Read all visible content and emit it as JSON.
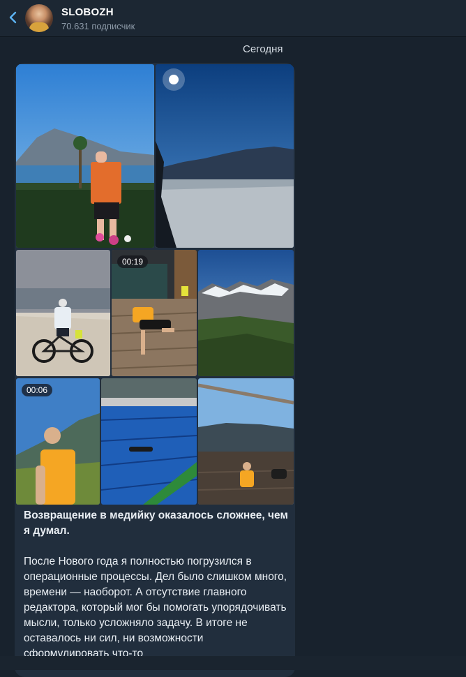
{
  "channel": {
    "name": "SLOBOZH",
    "subscribers": "70.631 подписчик"
  },
  "date_label": "Сегодня",
  "media": {
    "video_durations": [
      "00:19",
      "00:06"
    ]
  },
  "post": {
    "heading": "Возвращение в медийку оказалось сложнее, чем я думал.",
    "body": "После Нового года я полностью погрузился в операционные процессы. Дел было слишком много, времени — наоборот. А отсутствие главного редактора, который мог бы помогать упорядочивать мысли, только усложняло задачу. В итоге не оставалось ни сил, ни возможности сформулировать что-то"
  },
  "colors": {
    "background": "#18222d",
    "bubble": "#212e3d",
    "accent": "#5eb5f7"
  },
  "icons": [
    "back-arrow-icon"
  ]
}
